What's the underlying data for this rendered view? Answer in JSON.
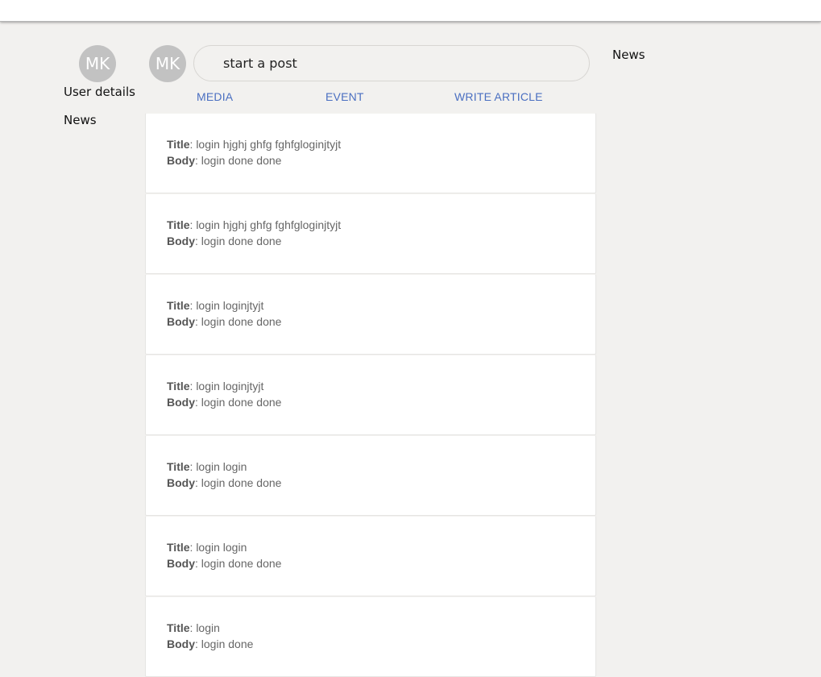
{
  "user": {
    "initials": "MK"
  },
  "left_nav": {
    "user_details": "User details",
    "news": "News"
  },
  "composer": {
    "placeholder": "start a post",
    "actions": {
      "media": "MEDIA",
      "event": "EVENT",
      "write_article": "WRITE ARTICLE"
    }
  },
  "right": {
    "news": "News"
  },
  "labels": {
    "title": "Title",
    "body": "Body"
  },
  "posts": [
    {
      "title": "login hjghj ghfg fghfgloginjtyjt",
      "body": "login done done"
    },
    {
      "title": "login hjghj ghfg fghfgloginjtyjt",
      "body": "login done done"
    },
    {
      "title": "login loginjtyjt",
      "body": "login done done"
    },
    {
      "title": "login loginjtyjt",
      "body": "login done done"
    },
    {
      "title": "login login",
      "body": "login done done"
    },
    {
      "title": "login login",
      "body": "login done done"
    },
    {
      "title": "login",
      "body": "login done"
    }
  ]
}
